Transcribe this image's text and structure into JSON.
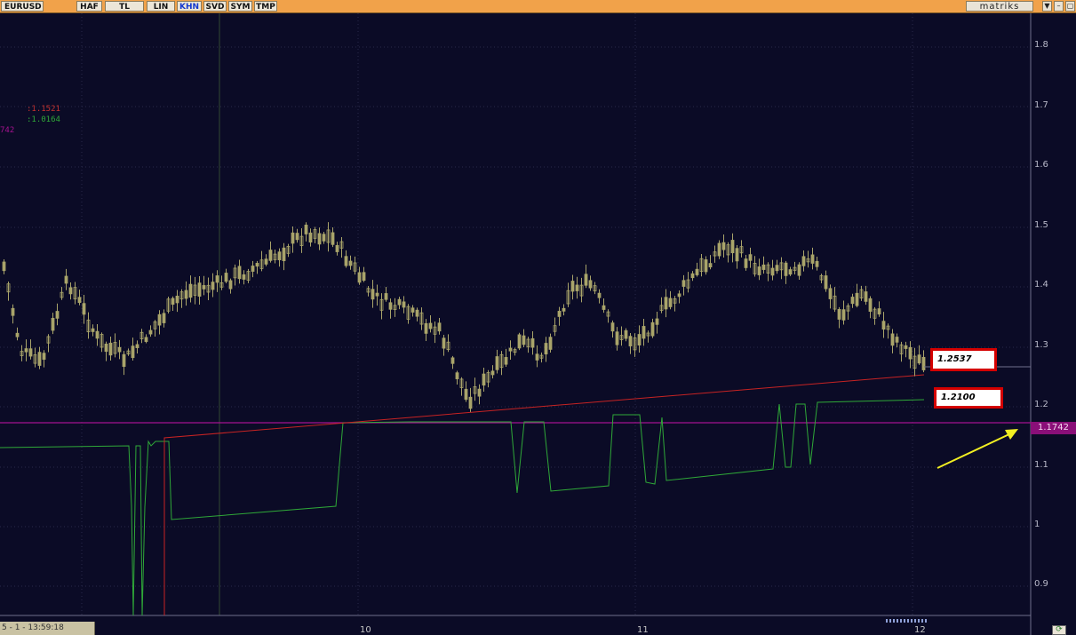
{
  "toolbar": {
    "symbol": "EURUSD",
    "buttons": [
      "HAF",
      "TL",
      "LIN",
      "KHN",
      "SVD",
      "SYM",
      "TMP"
    ],
    "active_button": "KHN",
    "brand": "matriks",
    "window_controls": [
      "▼",
      "–",
      "▢"
    ]
  },
  "legend": {
    "red_value": ":1.1521",
    "green_value": ":1.0164",
    "purple_value": "742"
  },
  "axis": {
    "y_ticks": [
      "1.8",
      "1.7",
      "1.6",
      "1.5",
      "1.4",
      "1.3",
      "1.2",
      "1.1",
      "1",
      "0.9"
    ],
    "x_ticks": [
      "10",
      "11",
      "12"
    ]
  },
  "annotations": {
    "box_upper": "1.2537",
    "box_lower": "1.2100",
    "price_tag": "1.1742"
  },
  "status_bar": {
    "text": "5 - 1 - 13:59:18"
  },
  "colors": {
    "background": "#0b0b26",
    "candle": "#a9a46a",
    "red_line": "#c72323",
    "green_line": "#2fa838",
    "purple_line": "#a4128f",
    "arrow": "#f2ef22",
    "toolbar": "#f1a24a"
  },
  "icons": {
    "corner": "refresh-icon",
    "arrow": "arrow-up-right-icon"
  }
}
